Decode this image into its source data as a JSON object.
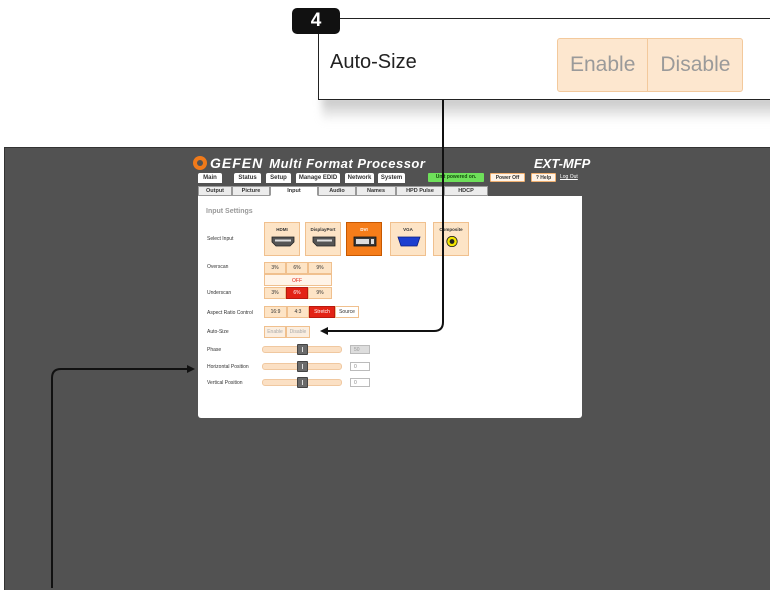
{
  "callout": {
    "step_number": "4",
    "label": "Auto-Size",
    "options": [
      "Enable",
      "Disable"
    ]
  },
  "app": {
    "logo": "GEFEN",
    "title": "Multi Format Processor",
    "model": "EXT-MFP"
  },
  "top_tabs": [
    "Main",
    "Status",
    "Setup",
    "Manage EDID",
    "Network",
    "System"
  ],
  "status": {
    "powered": "Unit powered on.",
    "power_off": "Power Off",
    "help": "? Help",
    "logout": "Log Out"
  },
  "sub_tabs": [
    "Output",
    "Picture",
    "Input",
    "Audio",
    "Names",
    "HPD Pulse",
    "HDCP"
  ],
  "active_sub_tab": "Input",
  "panel": {
    "title": "Input Settings",
    "select_input": {
      "label": "Select Input",
      "options": [
        "HDMI",
        "DisplayPort",
        "DVI",
        "VGA",
        "Composite"
      ],
      "selected": "DVI"
    },
    "overscan": {
      "label": "Overscan",
      "options": [
        "3%",
        "6%",
        "9%"
      ],
      "status": "OFF"
    },
    "underscan": {
      "label": "Underscan",
      "options": [
        "3%",
        "6%",
        "9%"
      ],
      "selected": "6%"
    },
    "aspect_ratio": {
      "label": "Aspect Ratio Control",
      "options": [
        "16:9",
        "4:3",
        "Stretch",
        "Source"
      ],
      "selected": "Stretch"
    },
    "auto_size": {
      "label": "Auto-Size",
      "options": [
        "Enable",
        "Disable"
      ]
    },
    "phase": {
      "label": "Phase",
      "value": "50",
      "level": 0.5
    },
    "horizontal_position": {
      "label": "Horizontal Position",
      "value": "0",
      "level": 0.5
    },
    "vertical_position": {
      "label": "Vertical Position",
      "value": "0",
      "level": 0.5
    }
  },
  "colors": {
    "accent_orange": "#f57d1a",
    "selected_red": "#e32315",
    "option_fill": "#fde4c6",
    "screen_grey": "#525252"
  }
}
